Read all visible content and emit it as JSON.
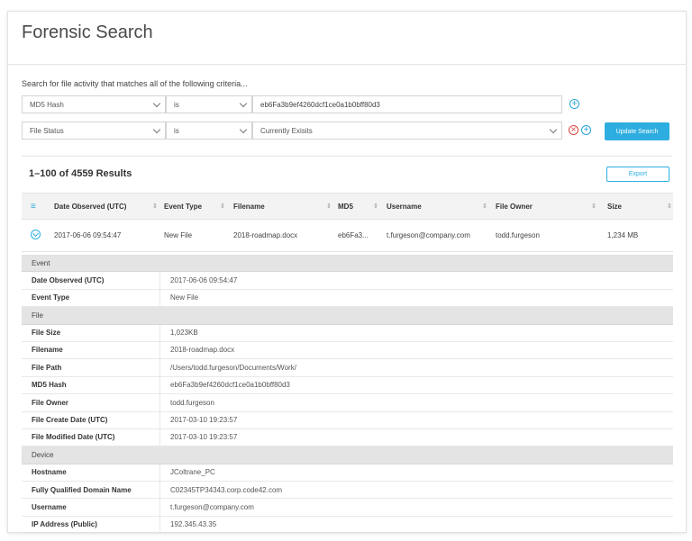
{
  "page": {
    "title": "Forensic Search",
    "criteria_label": "Search for file activity that matches all of the following criteria...",
    "accent_color": "#2eaee0",
    "remove_color": "#d9463e"
  },
  "criteria": [
    {
      "field": "MD5 Hash",
      "operator": "is",
      "value": "eb6Fa3b9ef4260dcf1ce0a1b0bff80d3",
      "value_type": "text",
      "icons": [
        "add-icon"
      ]
    },
    {
      "field": "File Status",
      "operator": "is",
      "value": "Currently Exisits",
      "value_type": "select",
      "icons": [
        "remove-icon",
        "add-icon"
      ]
    }
  ],
  "buttons": {
    "update": "Update Search",
    "export": "Export"
  },
  "results": {
    "count_label": "1–100 of 4559 Results",
    "columns": [
      "Date Observed (UTC)",
      "Event Type",
      "Filename",
      "MD5",
      "Username",
      "File Owner",
      "Size"
    ],
    "rows": [
      {
        "date": "2017-06-06 09:54:47",
        "event_type": "New File",
        "filename": "2018-roadmap.docx",
        "md5": "eb6Fa3...",
        "username": "t.furgeson@company.com",
        "file_owner": "todd.furgeson",
        "size": "1,234 MB"
      }
    ]
  },
  "details": [
    {
      "section": "Event"
    },
    {
      "label": "Date Observed (UTC)",
      "value": "2017-06-06 09:54:47"
    },
    {
      "label": "Event Type",
      "value": "New File"
    },
    {
      "section": "File"
    },
    {
      "label": "File Size",
      "value": "1,023KB"
    },
    {
      "label": "Filename",
      "value": "2018-roadmap.docx"
    },
    {
      "label": "File Path",
      "value": "/Users/todd.furgeson/Documents/Work/"
    },
    {
      "label": "MD5 Hash",
      "value": "eb6Fa3b9ef4260dcf1ce0a1b0bff80d3"
    },
    {
      "label": "File Owner",
      "value": "todd.furgeson"
    },
    {
      "label": "File Create Date (UTC)",
      "value": "2017-03-10 19:23:57"
    },
    {
      "label": "File Modified Date (UTC)",
      "value": "2017-03-10 19:23:57"
    },
    {
      "section": "Device"
    },
    {
      "label": "Hostname",
      "value": "JColtrane_PC"
    },
    {
      "label": "Fully Qualified Domain Name",
      "value": "C02345TP34343.corp.code42.com"
    },
    {
      "label": "Username",
      "value": "t.furgeson@company.com"
    },
    {
      "label": "IP Address (Public)",
      "value": "192.345.43.35"
    }
  ]
}
